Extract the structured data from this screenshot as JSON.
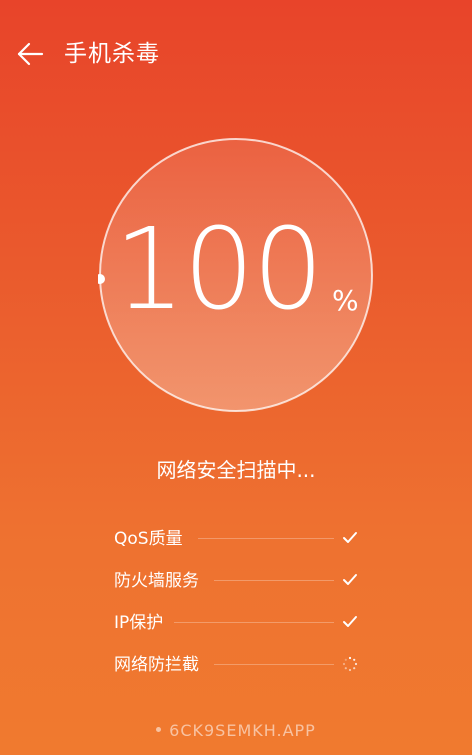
{
  "header": {
    "title": "手机杀毒",
    "back_icon": "back-arrow-icon"
  },
  "gauge": {
    "value": "100",
    "unit": "%",
    "progress": 1.0
  },
  "status": "网络安全扫描中...",
  "checks": [
    {
      "label": "QoS质量",
      "state": "done"
    },
    {
      "label": "防火墙服务",
      "state": "done"
    },
    {
      "label": "IP保护",
      "state": "done"
    },
    {
      "label": "网络防拦截",
      "state": "loading"
    }
  ],
  "footer": {
    "watermark": "6CK9SEMKH.APP"
  },
  "colors": {
    "background_top": "#e8442a",
    "background_bottom": "#f07a2f",
    "text": "#ffffff"
  }
}
